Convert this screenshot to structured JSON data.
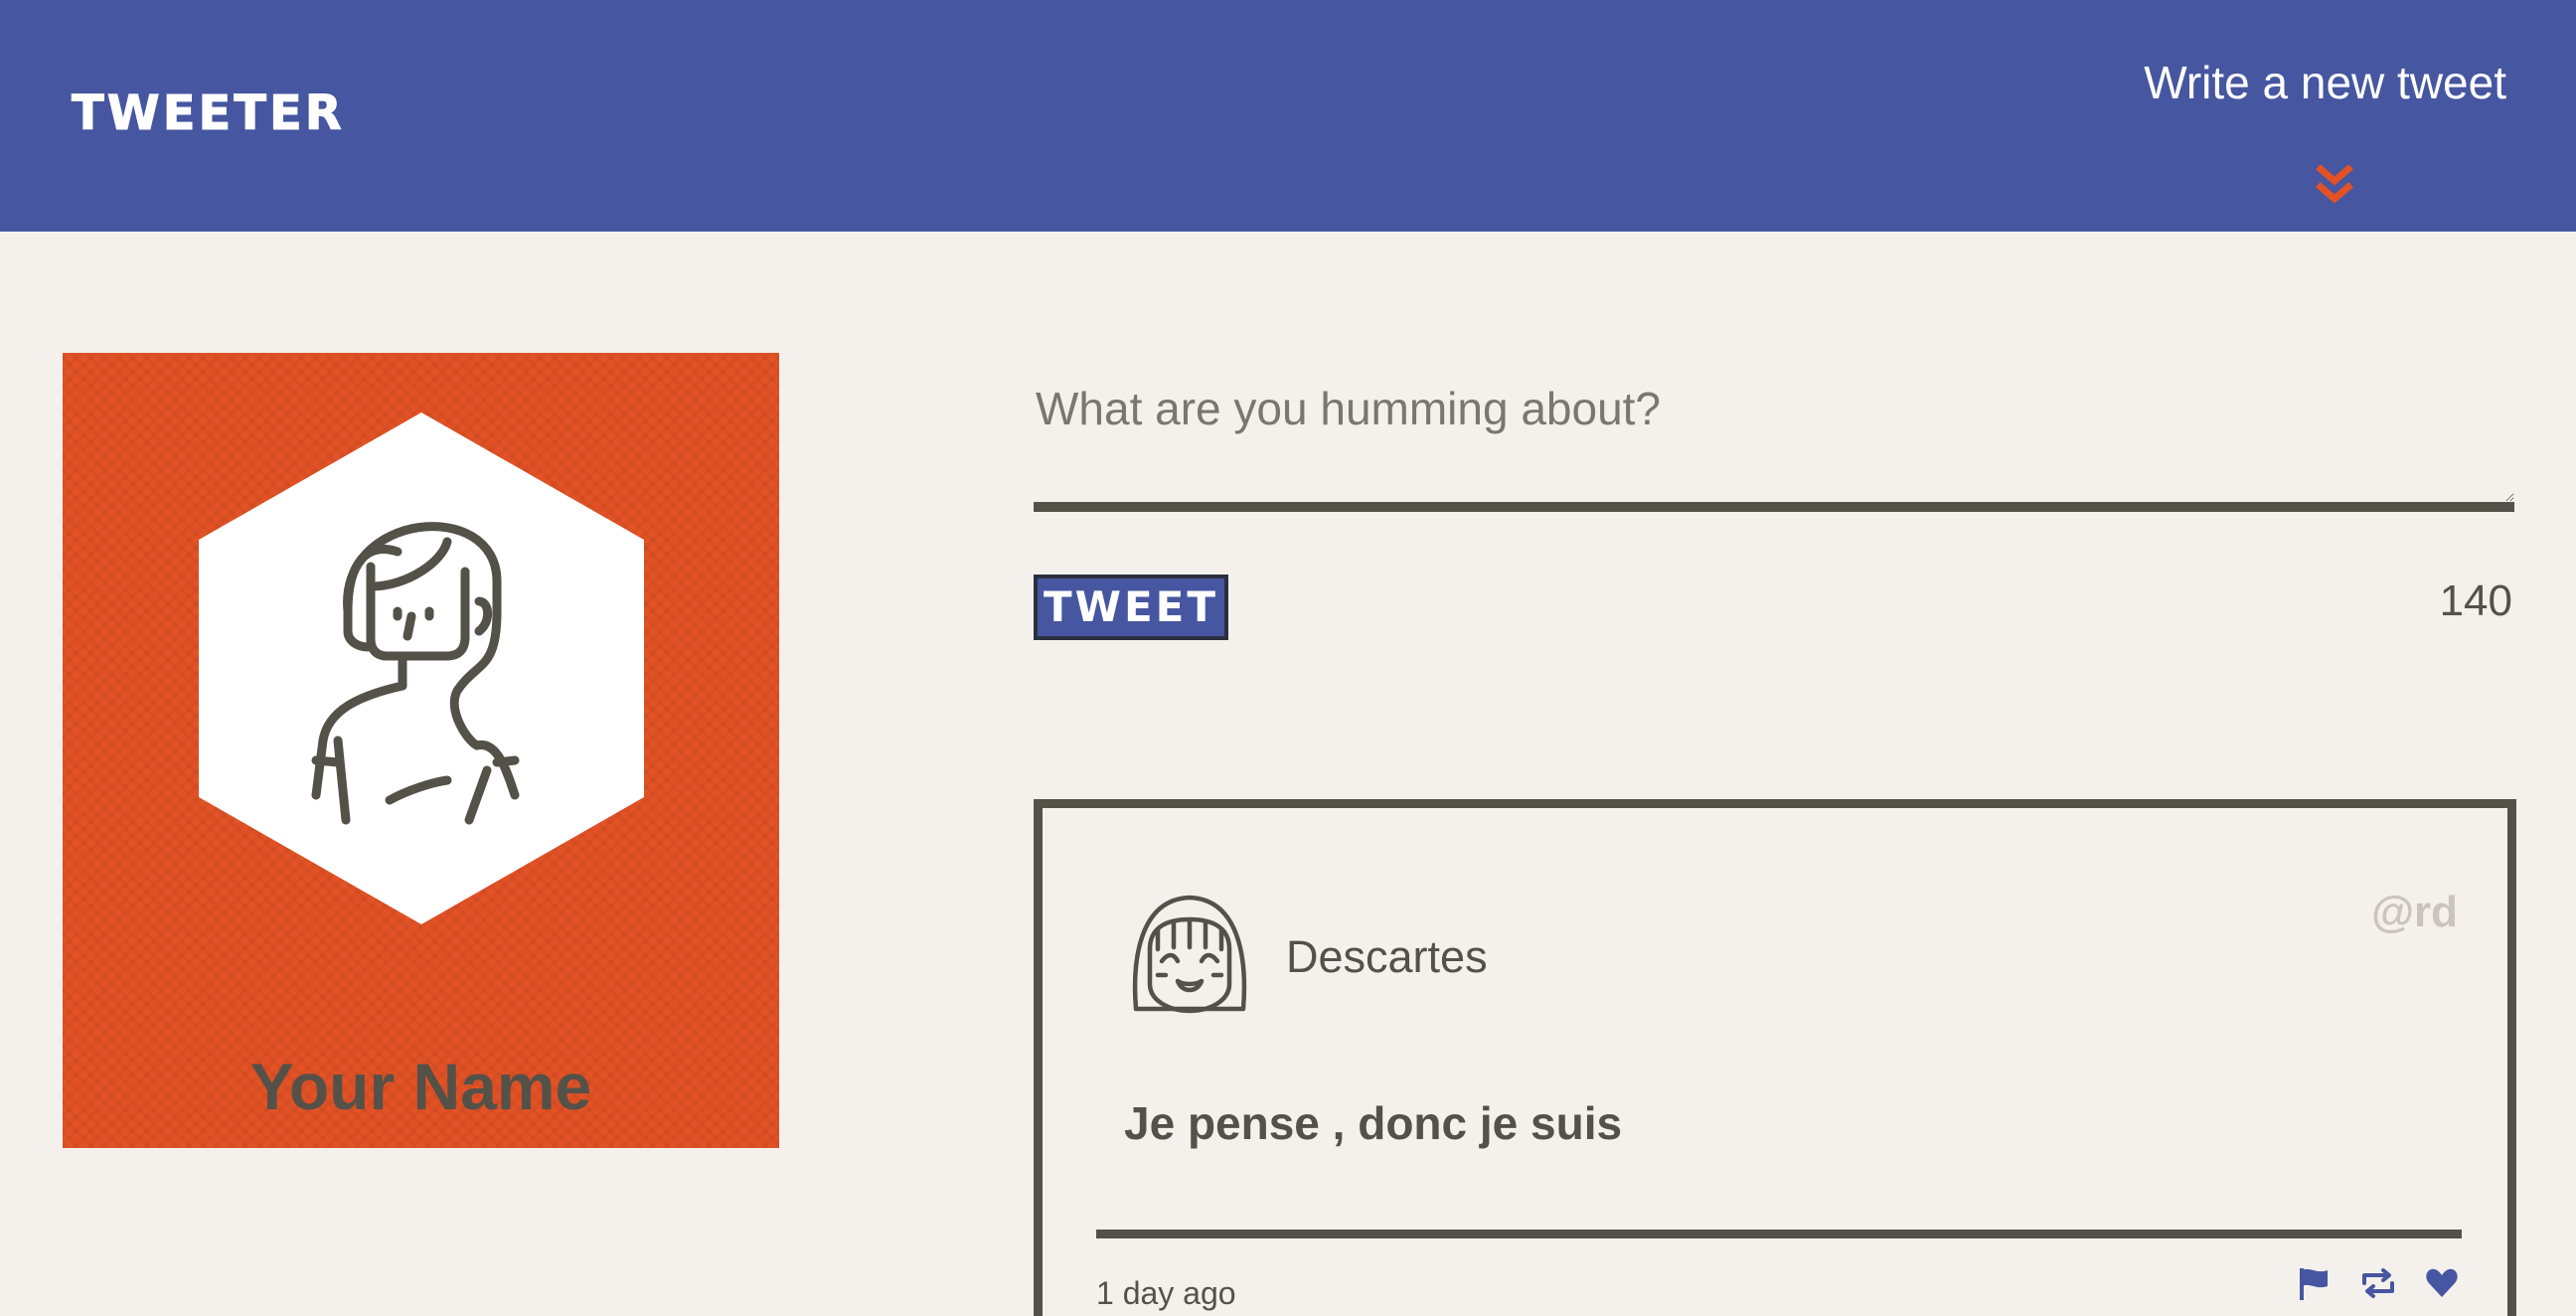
{
  "nav": {
    "brand": "TWEETER",
    "compose_link": "Write a new tweet",
    "chevron_icon": "double-chevron-down-icon"
  },
  "profile": {
    "name": "Your Name",
    "background_color": "#e25225"
  },
  "composer": {
    "placeholder": "What are you humming about?",
    "value": "",
    "button_label": "TWEET",
    "counter": "140"
  },
  "tweets": [
    {
      "name": "Descartes",
      "handle": "@rd",
      "content": "Je pense , donc je suis",
      "time": "1 day ago",
      "actions": [
        "flag-icon",
        "retweet-icon",
        "heart-icon"
      ]
    }
  ],
  "colors": {
    "nav": "#4656a0",
    "accent": "#e25225",
    "background": "#f4f1ec",
    "text": "#545149"
  }
}
